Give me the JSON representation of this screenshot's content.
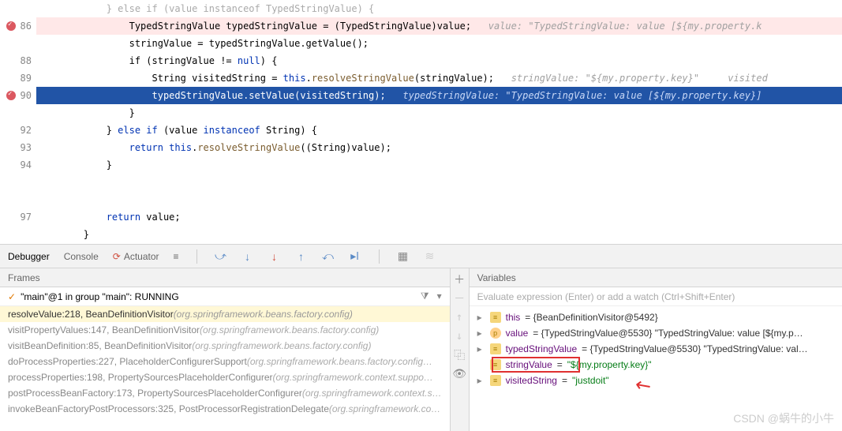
{
  "gutter": [
    "",
    "86",
    "  ",
    "88",
    "89",
    "90",
    "",
    "92",
    "93",
    "94",
    "",
    "",
    "97",
    ""
  ],
  "code": {
    "l0": "            } else if (value instanceof TypedStringValue) {",
    "l1_a": "                TypedStringValue typedStringValue = (TypedStringValue)value;   ",
    "l1_hint": "value: \"TypedStringValue: value [${my.property.k",
    "l2": "                stringValue = typedStringValue.getValue();",
    "l3_a": "                if (stringValue != ",
    "l3_null": "null",
    "l3_b": ") {",
    "l4_a": "                    String visitedString = ",
    "l4_this": "this",
    "l4_b": ".",
    "l4_call": "resolveStringValue",
    "l4_c": "(stringValue);   ",
    "l4_hint": "stringValue: \"${my.property.key}\"     visited",
    "l5_a": "                    typedStringValue.setValue(visitedString);   ",
    "l5_hint": "typedStringValue: \"TypedStringValue: value [${my.property.key}]",
    "l6": "                }",
    "l7_a": "            } ",
    "l7_else": "else if",
    "l7_b": " (value ",
    "l7_inst": "instanceof",
    "l7_c": " String) {",
    "l8_a": "                ",
    "l8_ret": "return this",
    "l8_b": ".",
    "l8_call": "resolveStringValue",
    "l8_c": "((String)value);",
    "l9": "            }",
    "l12_a": "            ",
    "l12_ret": "return",
    "l12_b": " value;",
    "l13": "        }"
  },
  "tabs": {
    "debugger": "Debugger",
    "console": "Console",
    "actuator": "Actuator"
  },
  "frames_header": "Frames",
  "vars_header": "Variables",
  "thread": "\"main\"@1 in group \"main\": RUNNING",
  "eval_placeholder": "Evaluate expression (Enter) or add a watch (Ctrl+Shift+Enter)",
  "frames": [
    {
      "m": "resolveValue:218, BeanDefinitionVisitor ",
      "p": "(org.springframework.beans.factory.config)",
      "sel": true
    },
    {
      "m": "visitPropertyValues:147, BeanDefinitionVisitor ",
      "p": "(org.springframework.beans.factory.config)",
      "sel": false
    },
    {
      "m": "visitBeanDefinition:85, BeanDefinitionVisitor ",
      "p": "(org.springframework.beans.factory.config)",
      "sel": false
    },
    {
      "m": "doProcessProperties:227, PlaceholderConfigurerSupport ",
      "p": "(org.springframework.beans.factory.config…",
      "sel": false
    },
    {
      "m": "processProperties:198, PropertySourcesPlaceholderConfigurer ",
      "p": "(org.springframework.context.suppo…",
      "sel": false
    },
    {
      "m": "postProcessBeanFactory:173, PropertySourcesPlaceholderConfigurer ",
      "p": "(org.springframework.context.s…",
      "sel": false
    },
    {
      "m": "invokeBeanFactoryPostProcessors:325, PostProcessorRegistrationDelegate ",
      "p": "(org.springframework.co…",
      "sel": false
    }
  ],
  "vars": [
    {
      "name": "this",
      "val": " = {BeanDefinitionVisitor@5492}",
      "icon": "f",
      "chev": true
    },
    {
      "name": "value",
      "val": " = {TypedStringValue@5530} \"TypedStringValue: value [${my.p…",
      "icon": "p",
      "chev": true
    },
    {
      "name": "typedStringValue",
      "val": " = {TypedStringValue@5530} \"TypedStringValue: val…",
      "icon": "f",
      "chev": true
    },
    {
      "name": "stringValue",
      "val": " = ",
      "str": "\"${my.property.key}\"",
      "icon": "f",
      "chev": false
    },
    {
      "name": "visitedString",
      "val": " = ",
      "str": "\"justdoit\"",
      "icon": "f",
      "chev": true
    }
  ],
  "watermark": "CSDN @蜗牛的小牛"
}
